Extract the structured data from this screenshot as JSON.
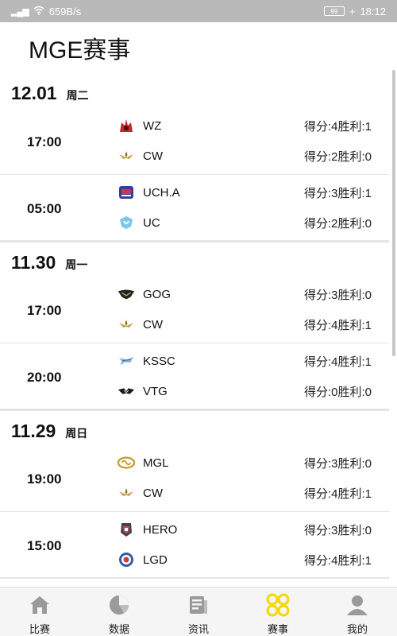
{
  "status_bar": {
    "network_speed": "659B/s",
    "battery": "99",
    "time": "18:12"
  },
  "page": {
    "title": "MGE赛事"
  },
  "colors": {
    "accent": "#f5d800",
    "tab_inactive": "#9a9a9a"
  },
  "days": [
    {
      "date": "12.01",
      "weekday": "周二",
      "matches": [
        {
          "time": "17:00",
          "team1": {
            "name": "WZ",
            "score": "得分:4胜利:1",
            "icon": "wz-logo-icon"
          },
          "team2": {
            "name": "CW",
            "score": "得分:2胜利:0",
            "icon": "cw-logo-icon"
          }
        },
        {
          "time": "05:00",
          "team1": {
            "name": "UCH.A",
            "score": "得分:3胜利:1",
            "icon": "ucha-logo-icon"
          },
          "team2": {
            "name": "UC",
            "score": "得分:2胜利:0",
            "icon": "uc-logo-icon"
          }
        }
      ]
    },
    {
      "date": "11.30",
      "weekday": "周一",
      "matches": [
        {
          "time": "17:00",
          "team1": {
            "name": "GOG",
            "score": "得分:3胜利:0",
            "icon": "gog-logo-icon"
          },
          "team2": {
            "name": "CW",
            "score": "得分:4胜利:1",
            "icon": "cw-logo-icon"
          }
        },
        {
          "time": "20:00",
          "team1": {
            "name": "KSSC",
            "score": "得分:4胜利:1",
            "icon": "kssc-logo-icon"
          },
          "team2": {
            "name": "VTG",
            "score": "得分:0胜利:0",
            "icon": "vtg-logo-icon"
          }
        }
      ]
    },
    {
      "date": "11.29",
      "weekday": "周日",
      "matches": [
        {
          "time": "19:00",
          "team1": {
            "name": "MGL",
            "score": "得分:3胜利:0",
            "icon": "mgl-logo-icon"
          },
          "team2": {
            "name": "CW",
            "score": "得分:4胜利:1",
            "icon": "cw-logo-icon"
          }
        },
        {
          "time": "15:00",
          "team1": {
            "name": "HERO",
            "score": "得分:3胜利:0",
            "icon": "hero-logo-icon"
          },
          "team2": {
            "name": "LGD",
            "score": "得分:4胜利:1",
            "icon": "lgd-logo-icon"
          }
        }
      ]
    }
  ],
  "tabs": [
    {
      "label": "比赛",
      "icon": "home-icon",
      "active": false
    },
    {
      "label": "数据",
      "icon": "pie-chart-icon",
      "active": false
    },
    {
      "label": "资讯",
      "icon": "news-icon",
      "active": false
    },
    {
      "label": "赛事",
      "icon": "events-grid-icon",
      "active": true
    },
    {
      "label": "我的",
      "icon": "profile-icon",
      "active": false
    }
  ]
}
